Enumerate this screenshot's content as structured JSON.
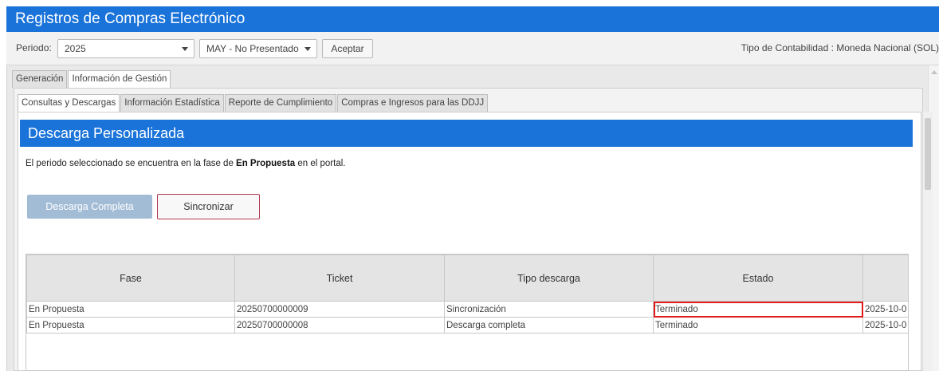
{
  "app": {
    "title": "Registros de Compras Electrónico"
  },
  "period": {
    "label": "Periodo:",
    "year": "2025",
    "month": "MAY - No Presentado",
    "accept_label": "Aceptar",
    "accounting_type": "Tipo de Contabilidad : Moneda Nacional (SOL)"
  },
  "tabs": {
    "top": [
      {
        "label": "Generación",
        "active": false
      },
      {
        "label": "Información de Gestión",
        "active": true
      }
    ],
    "sub": [
      {
        "label": "Consultas y Descargas",
        "active": true
      },
      {
        "label": "Información Estadística",
        "active": false
      },
      {
        "label": "Reporte de Cumplimiento",
        "active": false
      },
      {
        "label": "Compras e Ingresos para las DDJJ",
        "active": false
      }
    ]
  },
  "section": {
    "title": "Descarga Personalizada",
    "message_prefix": "El periodo seleccionado se encuentra en la fase de ",
    "message_phase": "En Propuesta",
    "message_suffix": " en el portal."
  },
  "actions": {
    "full_download_label": "Descarga Completa",
    "sync_label": "Sincronizar"
  },
  "table": {
    "columns": [
      "Fase",
      "Ticket",
      "Tipo descarga",
      "Estado",
      ""
    ],
    "rows": [
      [
        "En Propuesta",
        "20250700000009",
        "Sincronización",
        "Terminado",
        "2025-10-0"
      ],
      [
        "En Propuesta",
        "20250700000008",
        "Descarga completa",
        "Terminado",
        "2025-10-0"
      ]
    ]
  },
  "colors": {
    "primary": "#1a73d9",
    "disabled_button": "#a3bcd6",
    "sync_border": "#b03a4f",
    "highlight": "#e01c1c"
  }
}
